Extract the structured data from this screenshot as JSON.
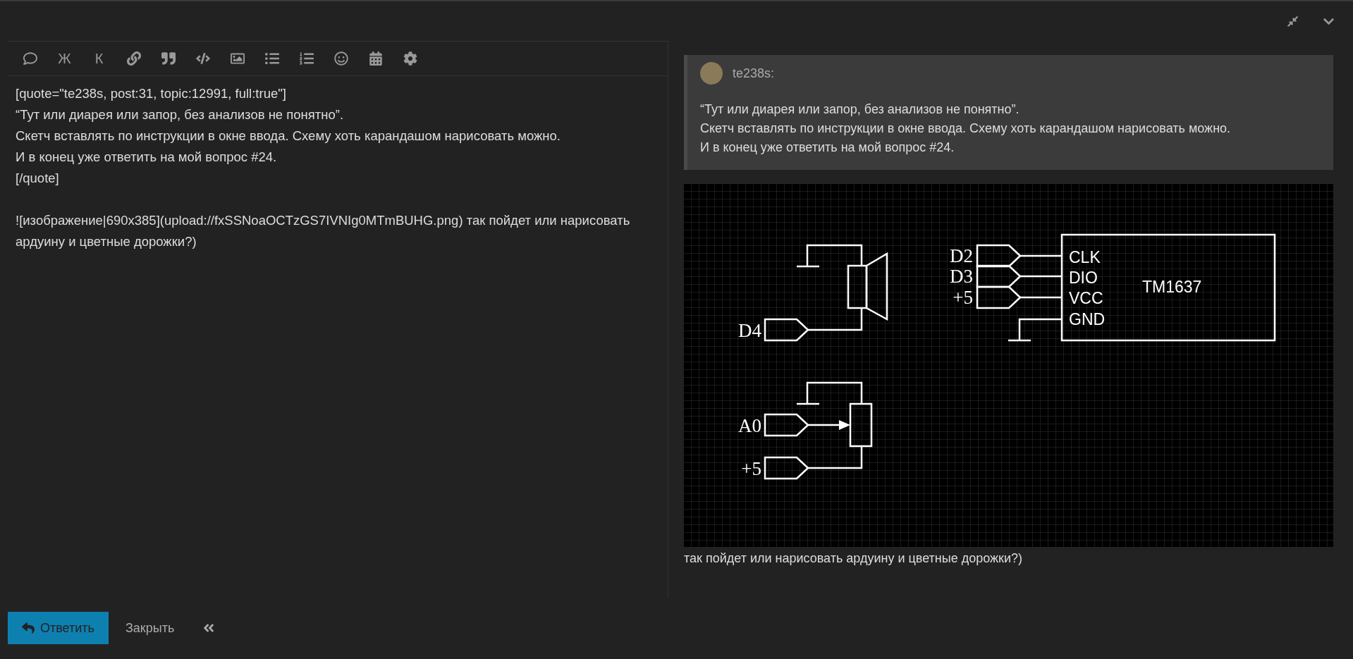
{
  "toolbar": [
    {
      "kind": "icon"
    },
    {
      "kind": "text",
      "label": "Ж"
    },
    {
      "kind": "text",
      "label": "К"
    },
    {
      "kind": "icon"
    },
    {
      "kind": "icon"
    },
    {
      "kind": "icon"
    },
    {
      "kind": "icon"
    },
    {
      "kind": "icon"
    },
    {
      "kind": "icon"
    },
    {
      "kind": "icon"
    },
    {
      "kind": "icon"
    },
    {
      "kind": "icon"
    }
  ],
  "editor": {
    "paragraphs": [
      [
        "[quote=\"te238s, post:31, topic:12991, full:true\"]",
        "“Тут или диарея или запор, без анализов не понятно”.",
        "Скетч вставлять по инструкции в окне ввода. Схему хоть карандашом нарисовать можно.",
        "И в конец уже ответить на мой вопрос #24.",
        "[/quote]"
      ],
      [
        "![изображение|690x385](upload://fxSSNoaOCTzGS7IVNIg0MTmBUHG.png) так пойдет или нарисовать ардуину и цветные дорожки?)"
      ]
    ]
  },
  "preview": {
    "quote": {
      "author": "te238s:",
      "lines": [
        "“Тут или диарея или запор, без анализов не понятно”.",
        "Скетч вставлять по инструкции в окне ввода. Схему хоть карандашом нарисовать можно.",
        "И в конец уже ответить на мой вопрос #24."
      ]
    },
    "schematic": {
      "chip": "TM1637",
      "pins": [
        "CLK",
        "DIO",
        "VCC",
        "GND"
      ],
      "chip_inputs": [
        "D2",
        "D3",
        "+5"
      ],
      "speaker_input": "D4",
      "pot_inputs": [
        "A0",
        "+5"
      ]
    },
    "caption": "так пойдет или нарисовать ардуину и цветные дорожки?)"
  },
  "footer": {
    "reply": "Ответить",
    "close": "Закрыть"
  }
}
